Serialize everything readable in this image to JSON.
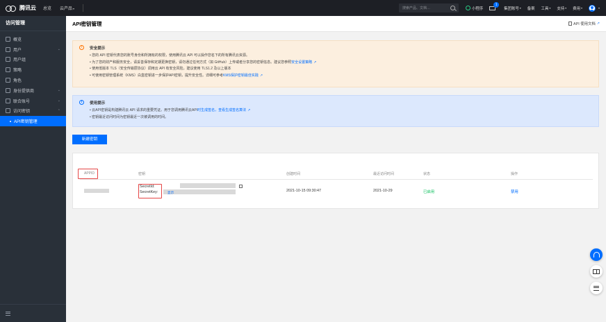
{
  "topbar": {
    "brand": "腾讯云",
    "nav": [
      "总览",
      "云产品"
    ],
    "search_placeholder": "搜索产品、文档…",
    "items": [
      "小程序",
      "集团账号",
      "备案",
      "工具",
      "支持",
      "费用"
    ],
    "mail_badge": "1"
  },
  "sidebar": {
    "title": "访问管理",
    "items": [
      {
        "label": "概览",
        "icon": "grid-icon",
        "arrow": ""
      },
      {
        "label": "用户",
        "icon": "user-icon",
        "arrow": "⌄"
      },
      {
        "label": "用户组",
        "icon": "group-icon",
        "arrow": ""
      },
      {
        "label": "策略",
        "icon": "policy-icon",
        "arrow": ""
      },
      {
        "label": "角色",
        "icon": "role-icon",
        "arrow": ""
      },
      {
        "label": "身份提供商",
        "icon": "idp-icon",
        "arrow": "⌄"
      },
      {
        "label": "联合账号",
        "icon": "federation-icon",
        "arrow": "⌄"
      },
      {
        "label": "访问密钥",
        "icon": "key-icon",
        "arrow": "⌃"
      }
    ],
    "active_item": "API密钥管理"
  },
  "page": {
    "title": "API密钥管理",
    "doc_link": "API 使用文档"
  },
  "alert_security": {
    "title": "安全提示",
    "lines": [
      {
        "text": "• 您的 API 密钥代表您的账号身份和所拥有的权限，使用腾讯云 API 可以操作您名下的所有腾讯云资源。",
        "link": ""
      },
      {
        "text": "• 为了您的财产和服务安全，请妥善保存和定期更换密钥，请勿通过任何方式（如 GitHub）上传或者分享您的密钥信息。建议您参照",
        "link": "安全设置策略"
      },
      {
        "text": "• 使用低版本 TLS（安全传输层协议）调用云 API 有安全风险，建议使用 TLS1.2 及以上版本",
        "link": ""
      },
      {
        "text": "• 可使用密钥管理系统（KMS）白盒密钥进一步保护API密钥，提升安全性。详细可参考",
        "link": "KMS保护密钥最佳实践"
      }
    ]
  },
  "alert_usage": {
    "title": "使用提示",
    "lines": [
      {
        "text": "• 云API密钥是构建腾讯云 API 请求的重要凭证。用于您调用腾讯云API",
        "link": "时生成签名，查看生成签名算法"
      },
      {
        "text": "• 密钥最近访问时间为密钥最近一次被调用的时间。",
        "link": ""
      }
    ]
  },
  "create_button": "新建密钥",
  "table": {
    "headers": [
      "APPID",
      "密钥",
      "创建时间",
      "最近访问时间",
      "状态",
      "操作"
    ],
    "row": {
      "secret_id_label": "SecretId:",
      "secret_key_label": "SecretKey:",
      "show_link": "显示",
      "created": "2021-10-15 09:30:47",
      "last_access": "2021-10-29",
      "status": "已启用",
      "action": "禁用"
    }
  },
  "colors": {
    "accent": "#006eff",
    "status_ok": "#0abf5b",
    "highlight": "#e54545"
  }
}
